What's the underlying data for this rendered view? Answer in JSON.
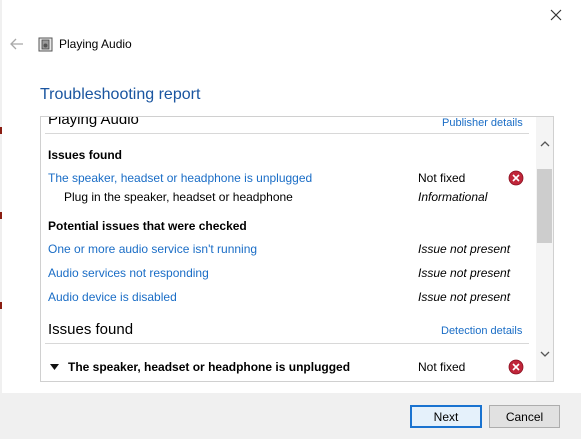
{
  "window": {
    "title": "Playing Audio"
  },
  "report": {
    "title": "Troubleshooting report",
    "top_section": {
      "heading": "Playing Audio",
      "link": "Publisher details"
    },
    "issues_found_1": {
      "label": "Issues found",
      "item": {
        "title": "The speaker, headset or headphone is unplugged",
        "status": "Not fixed"
      },
      "detail": {
        "text": "Plug in the speaker, headset or headphone",
        "status": "Informational"
      }
    },
    "potential": {
      "label": "Potential issues that were checked",
      "items": [
        {
          "title": "One or more audio service isn't running",
          "status": "Issue not present"
        },
        {
          "title": "Audio services not responding",
          "status": "Issue not present"
        },
        {
          "title": "Audio device is disabled",
          "status": "Issue not present"
        }
      ]
    },
    "issues_found_2": {
      "label": "Issues found",
      "link": "Detection details",
      "item": {
        "title": "The speaker, headset or headphone is unplugged",
        "status": "Not fixed"
      }
    }
  },
  "footer": {
    "next_label": "Next",
    "cancel_label": "Cancel"
  },
  "colors": {
    "link": "#1a6dc6",
    "title": "#1a55a0",
    "error": "#c0263a",
    "primary_border": "#1a73d0"
  }
}
